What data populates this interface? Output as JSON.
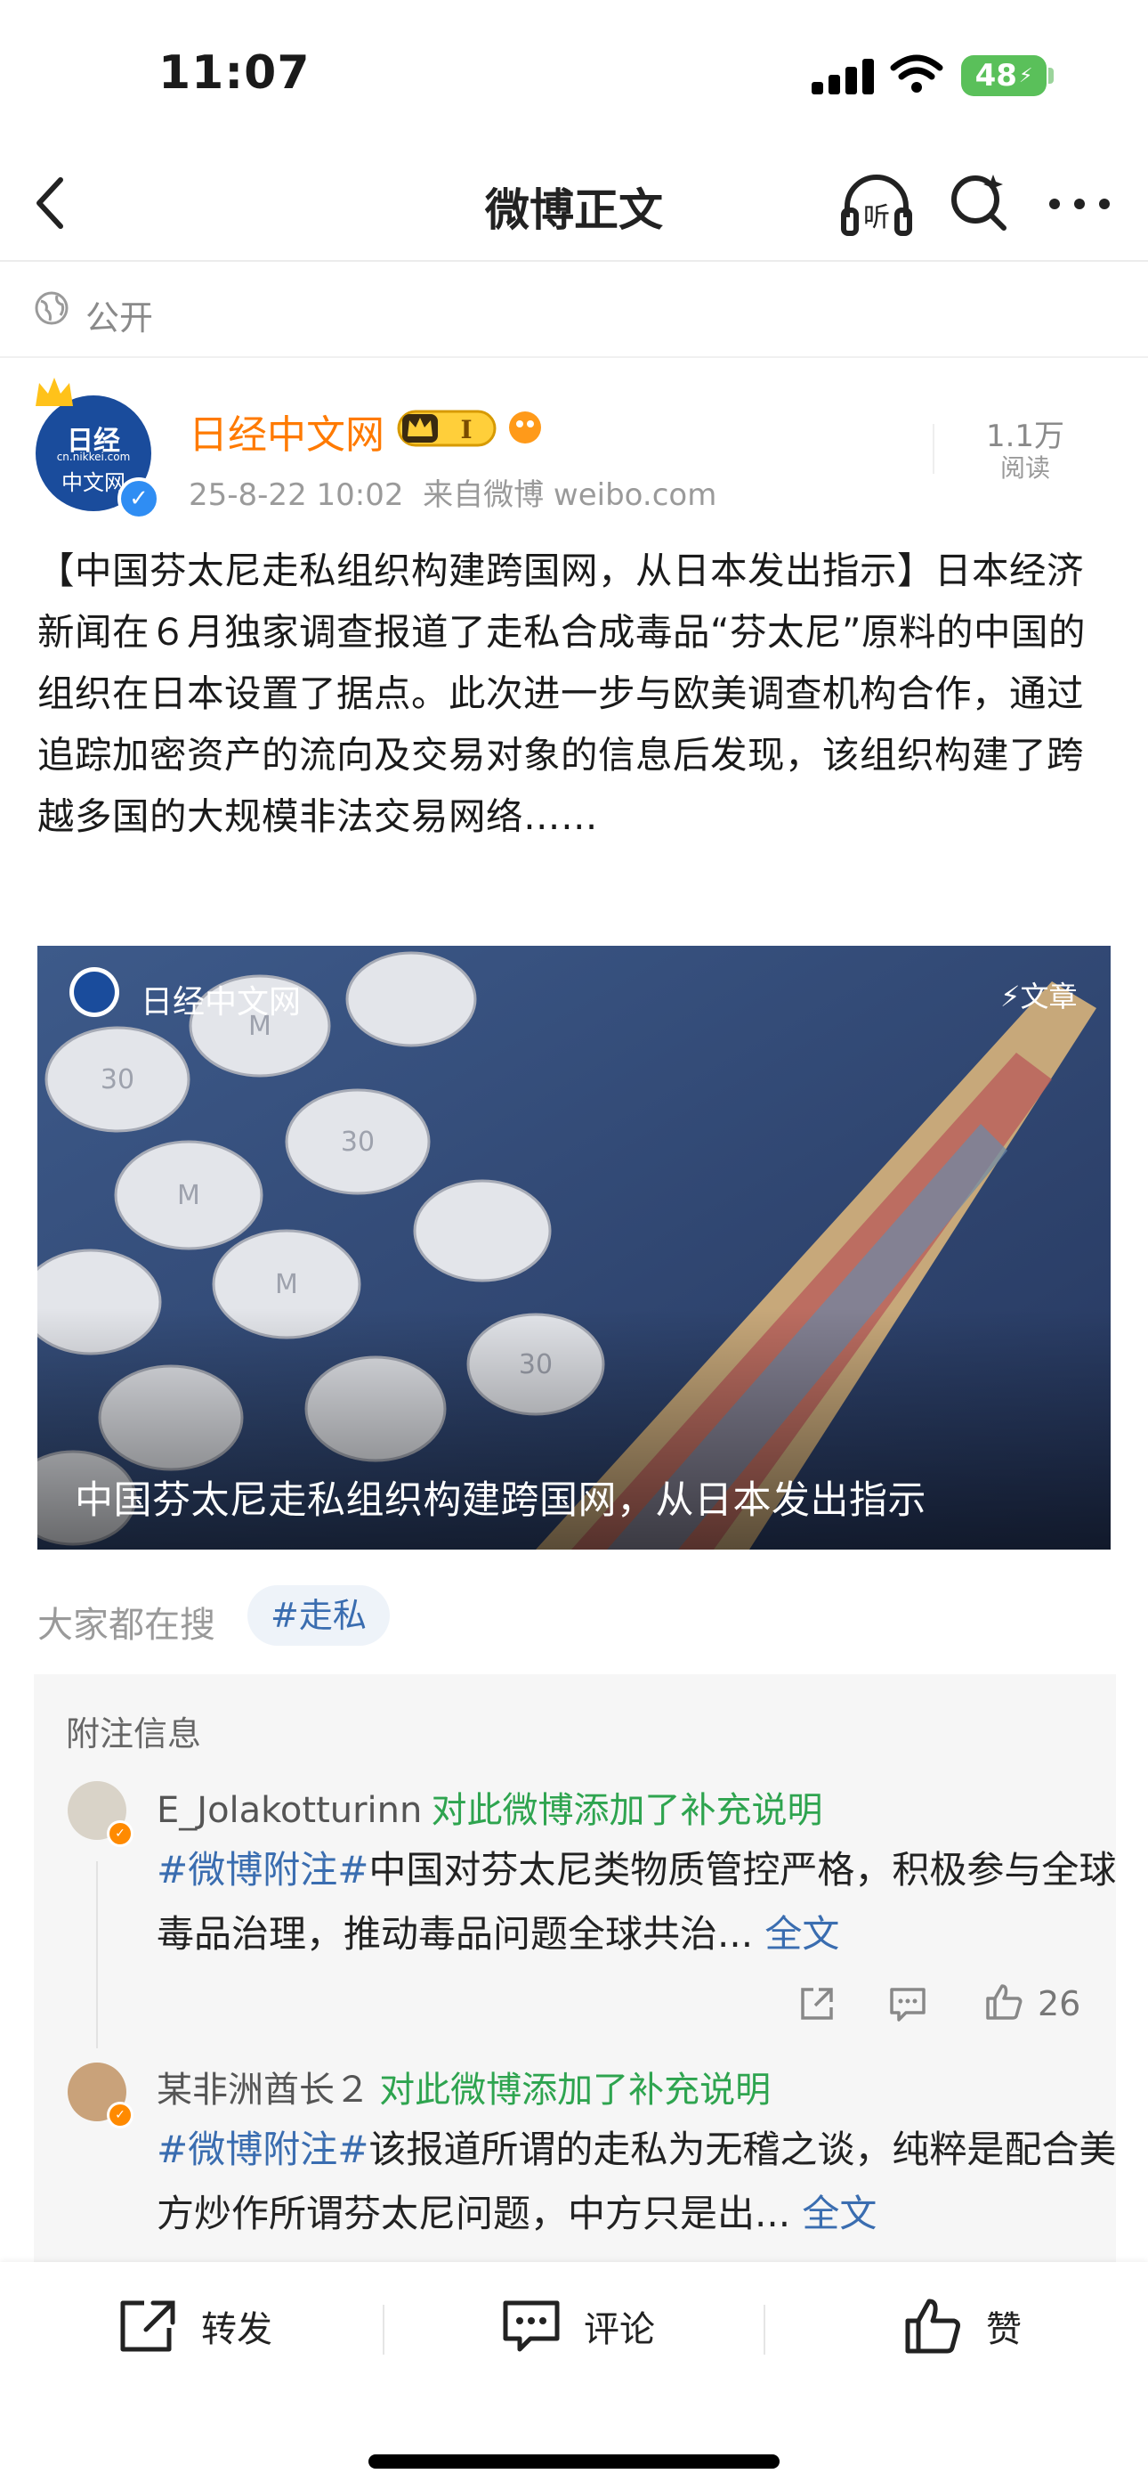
{
  "status_bar": {
    "time": "11:07",
    "battery": "48"
  },
  "nav": {
    "title": "微博正文"
  },
  "visibility": {
    "label": "公开"
  },
  "author": {
    "avatar_text_top": "日经",
    "avatar_text_mid": "cn.nikkei.com",
    "avatar_text_bot": "中文网",
    "name": "日经中文网",
    "time": "25-8-22 10:02",
    "source": "来自微博 weibo.com",
    "reads": "1.1万",
    "reads_label": "阅读"
  },
  "post": {
    "text": "【中国芬太尼走私组织构建跨国网，从日本发出指示】日本经济新闻在６月独家调查报道了走私合成毒品“芬太尼”原料的中国的组织在日本设置了据点。此次进一步与欧美调查机构合作，通过追踪加密资产的流向及交易对象的信息后发现，该组织构建了跨越多国的大规模非法交易网络……"
  },
  "card": {
    "source": "日经中文网",
    "tag": "文章",
    "title": "中国芬太尼走私组织构建跨国网，从日本发出指示",
    "pill_labels": [
      "30",
      "M"
    ]
  },
  "hot_search": {
    "label": "大家都在搜",
    "chip": "#走私"
  },
  "notes": {
    "title": "附注信息",
    "items": [
      {
        "user": "E_Jolakotturinn",
        "action": "对此微博添加了补充说明",
        "tag": "#微博附注#",
        "text": "中国对芬太尼类物质管控严格，积极参与全球毒品治理，推动毒品问题全球共治...",
        "more": "全文",
        "likes": "26"
      },
      {
        "user": "某非洲酋长２",
        "action": "对此微博添加了补充说明",
        "tag": "#微博附注#",
        "text": "该报道所谓的走私为无稽之谈，纯粹是配合美方炒作所谓芬太尼问题，中方只是出...",
        "more": "全文"
      }
    ]
  },
  "bottom_bar": {
    "repost": "转发",
    "comment": "评论",
    "like": "赞"
  },
  "colors": {
    "accent_orange": "#ff7a00",
    "link_blue": "#3a6db0",
    "green": "#2ea44f"
  }
}
